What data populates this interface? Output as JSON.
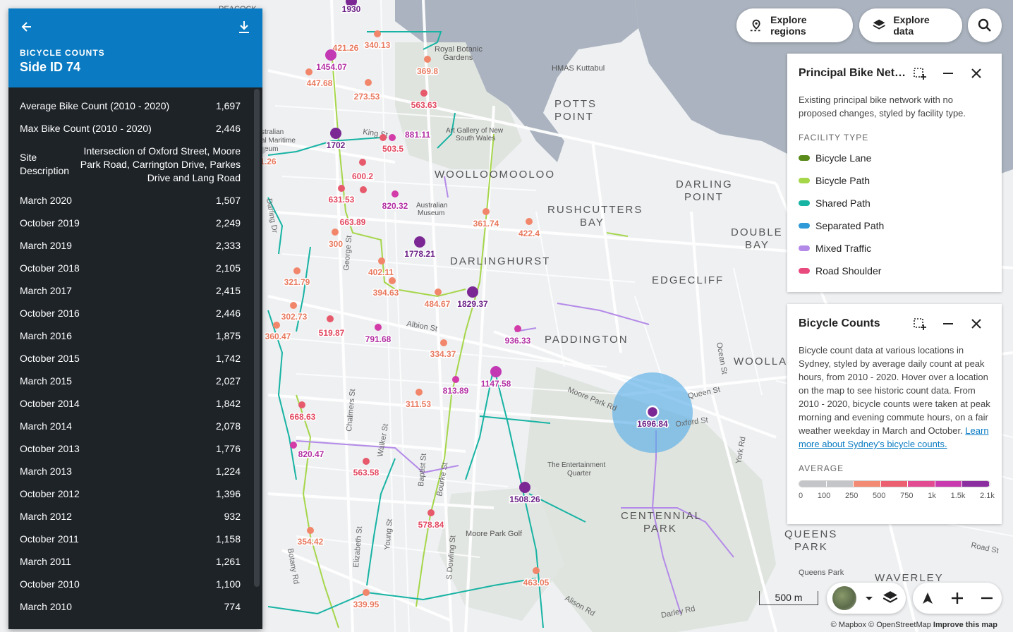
{
  "map": {
    "places": [
      {
        "name": "Royal Botanic\nGardens"
      },
      {
        "name": "HMAS Kuttabul"
      },
      {
        "name": "POTTS\nPOINT"
      },
      {
        "name": "Art Gallery of New\nSouth Wales"
      },
      {
        "name": "WOOLLOOMOOLOO"
      },
      {
        "name": "DARLING\nPOINT"
      },
      {
        "name": "RUSHCUTTERS\nBAY"
      },
      {
        "name": "Australian\nMuseum"
      },
      {
        "name": "DOUBLE\nBAY"
      },
      {
        "name": "DARLINGHURST"
      },
      {
        "name": "EDGECLIFF"
      },
      {
        "name": "PADDINGTON"
      },
      {
        "name": "WOOLLA"
      },
      {
        "name": "The Entertainment\nQuarter"
      },
      {
        "name": "CENTENNIAL\nPARK"
      },
      {
        "name": "QUEENS\nPARK"
      },
      {
        "name": "Moore Park Golf"
      },
      {
        "name": "Queens Park"
      },
      {
        "name": "WAVERLEY"
      },
      {
        "name": "PEACOCK"
      },
      {
        "name": "stralian\nal Maritime\nseum"
      }
    ],
    "streets": [
      "King St",
      "Albion St",
      "Moore Park Rd",
      "Oxford St",
      "Queen St",
      "Ocean St",
      "York Rd",
      "George St",
      "Chalmers St",
      "Walker St",
      "Baptist St",
      "Bourke St",
      "Elizabeth St",
      "Young St",
      "S Dowling St",
      "Botany Rd",
      "Darling Dr",
      "Alison Rd",
      "Darley Rd",
      "Road St"
    ],
    "counts": [
      {
        "label": "1930"
      },
      {
        "label": "340.13"
      },
      {
        "label": "421.26"
      },
      {
        "label": "1454.07"
      },
      {
        "label": "369.8"
      },
      {
        "label": "447.68"
      },
      {
        "label": "273.53"
      },
      {
        "label": "563.63"
      },
      {
        "label": "881.11"
      },
      {
        "label": "503.5"
      },
      {
        "label": "1702"
      },
      {
        "label": "1.26"
      },
      {
        "label": "600.2"
      },
      {
        "label": "631.53"
      },
      {
        "label": "820.32"
      },
      {
        "label": "361.74"
      },
      {
        "label": "422.4"
      },
      {
        "label": "663.89"
      },
      {
        "label": "300"
      },
      {
        "label": "1778.21"
      },
      {
        "label": "402.11"
      },
      {
        "label": "321.79"
      },
      {
        "label": "394.63"
      },
      {
        "label": "484.67"
      },
      {
        "label": "1829.37"
      },
      {
        "label": "302.73"
      },
      {
        "label": "519.87"
      },
      {
        "label": "791.68"
      },
      {
        "label": "936.33"
      },
      {
        "label": "360.47"
      },
      {
        "label": "334.37"
      },
      {
        "label": "1147.58"
      },
      {
        "label": "813.89"
      },
      {
        "label": "311.53"
      },
      {
        "label": "668.63"
      },
      {
        "label": "1696.84"
      },
      {
        "label": "820.47"
      },
      {
        "label": "563.58"
      },
      {
        "label": "1508.26"
      },
      {
        "label": "578.84"
      },
      {
        "label": "354.42"
      },
      {
        "label": "463.05"
      },
      {
        "label": "339.95"
      }
    ]
  },
  "toolbar": {
    "explore_regions": "Explore regions",
    "explore_data": "Explore data"
  },
  "site": {
    "eyebrow": "BICYCLE COUNTS",
    "title": "Side ID 74",
    "average_label": "Average Bike Count (2010 - 2020)",
    "average_value": "1,697",
    "max_label": "Max Bike Count (2010 - 2020)",
    "max_value": "2,446",
    "desc_label": "Site\nDescription",
    "desc_value": "Intersection of Oxford Street, Moore Park Road, Carrington Drive, Parkes Drive and Lang Road",
    "history": [
      {
        "period": "March 2020",
        "count": "1,507"
      },
      {
        "period": "October 2019",
        "count": "2,249"
      },
      {
        "period": "March 2019",
        "count": "2,333"
      },
      {
        "period": "October 2018",
        "count": "2,105"
      },
      {
        "period": "March 2017",
        "count": "2,415"
      },
      {
        "period": "October 2016",
        "count": "2,446"
      },
      {
        "period": "March 2016",
        "count": "1,875"
      },
      {
        "period": "October 2015",
        "count": "1,742"
      },
      {
        "period": "March 2015",
        "count": "2,027"
      },
      {
        "period": "October 2014",
        "count": "1,842"
      },
      {
        "period": "March 2014",
        "count": "2,078"
      },
      {
        "period": "October 2013",
        "count": "1,776"
      },
      {
        "period": "March 2013",
        "count": "1,224"
      },
      {
        "period": "October 2012",
        "count": "1,396"
      },
      {
        "period": "March 2012",
        "count": "932"
      },
      {
        "period": "October 2011",
        "count": "1,158"
      },
      {
        "period": "March 2011",
        "count": "1,261"
      },
      {
        "period": "October 2010",
        "count": "1,100"
      },
      {
        "period": "March 2010",
        "count": "774"
      }
    ]
  },
  "network_card": {
    "title": "Principal Bike Net…",
    "description": "Existing principal bike network with no proposed changes, styled by facility type.",
    "section": "FACILITY TYPE",
    "items": [
      {
        "label": "Bicycle Lane",
        "color": "#5a8a1a"
      },
      {
        "label": "Bicycle Path",
        "color": "#a6d64a"
      },
      {
        "label": "Shared Path",
        "color": "#17b3a3"
      },
      {
        "label": "Separated Path",
        "color": "#2f9ad8"
      },
      {
        "label": "Mixed Traffic",
        "color": "#b48ae8"
      },
      {
        "label": "Road Shoulder",
        "color": "#e84a7e"
      }
    ]
  },
  "counts_card": {
    "title": "Bicycle Counts",
    "description": "Bicycle count data at various locations in Sydney, styled by average daily count at peak hours, from 2010 - 2020. Hover over a location on the map to see historic count data. From 2010 - 2020, bicycle counts were taken at peak morning and evening commute hours, on a fair weather weekday in March and October. ",
    "link": "Learn more about Sydney's bicycle counts.",
    "section": "AVERAGE",
    "ramp_colors": [
      "#c3c5c8",
      "#c3c5c8",
      "#f28a74",
      "#eb5f70",
      "#e24a92",
      "#c83aae",
      "#8b2fa0"
    ],
    "ticks": [
      "0",
      "100",
      "250",
      "500",
      "750",
      "1k",
      "1.5k",
      "2.1k"
    ]
  },
  "scale": {
    "label": "500 m"
  },
  "attribution": {
    "mapbox": "© Mapbox",
    "osm": "© OpenStreetMap",
    "improve": "Improve this map"
  }
}
